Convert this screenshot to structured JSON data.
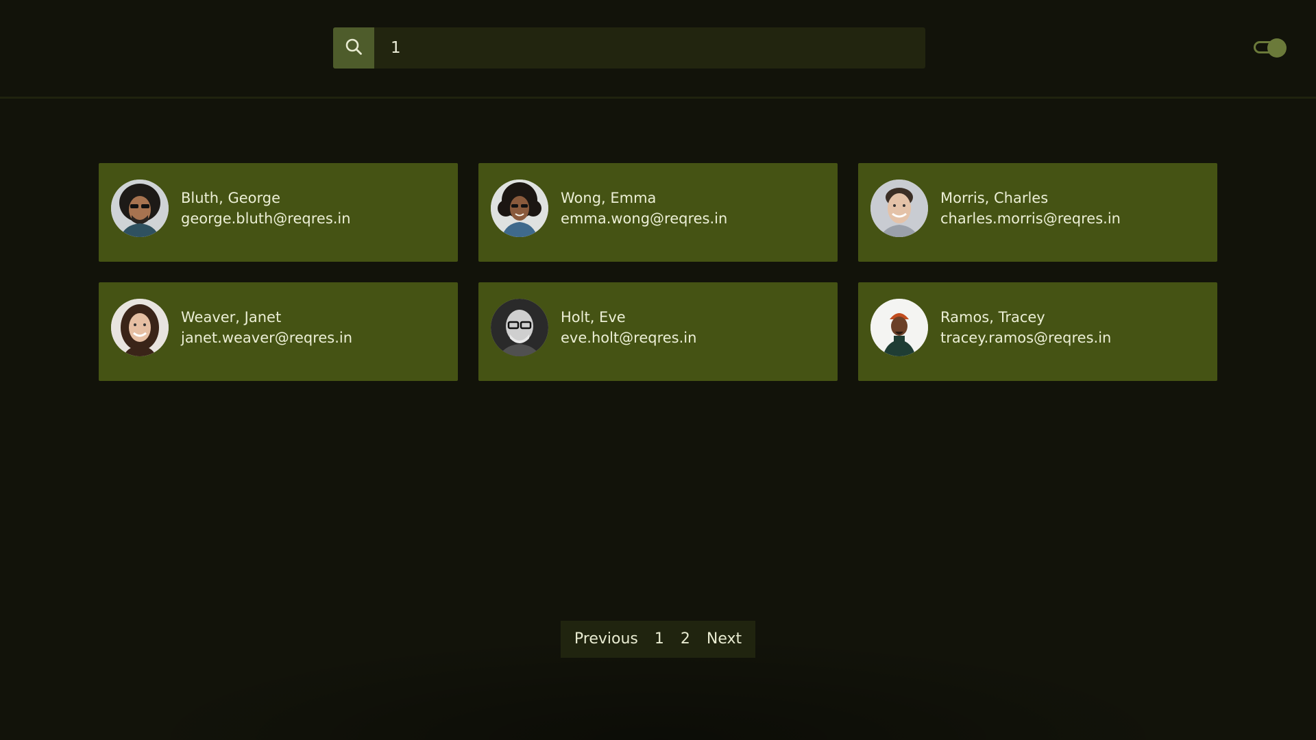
{
  "header": {
    "search": {
      "value": "1",
      "icon": "search-icon"
    },
    "theme_toggle": {
      "icon": "toggle-icon",
      "state": "on"
    }
  },
  "users": [
    {
      "name": "Bluth, George",
      "email": "george.bluth@reqres.in"
    },
    {
      "name": "Wong, Emma",
      "email": "emma.wong@reqres.in"
    },
    {
      "name": "Morris, Charles",
      "email": "charles.morris@reqres.in"
    },
    {
      "name": "Weaver, Janet",
      "email": "janet.weaver@reqres.in"
    },
    {
      "name": "Holt, Eve",
      "email": "eve.holt@reqres.in"
    },
    {
      "name": "Ramos, Tracey",
      "email": "tracey.ramos@reqres.in"
    }
  ],
  "pagination": {
    "previous": "Previous",
    "pages": [
      "1",
      "2"
    ],
    "next": "Next"
  },
  "colors": {
    "background": "#12130a",
    "card": "#455314",
    "accent": "#4e5c2b",
    "search_bg": "#22250f",
    "pagination_bg": "#20240f"
  }
}
